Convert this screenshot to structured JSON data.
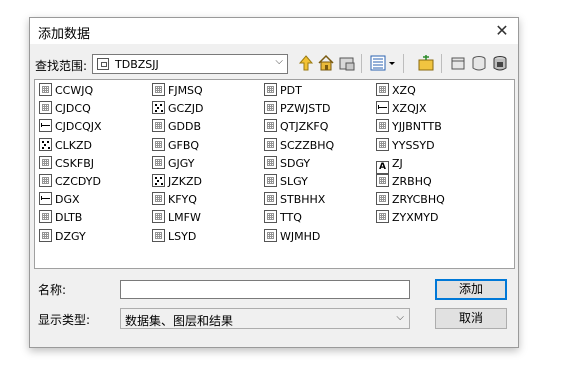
{
  "dialog": {
    "title": "添加数据"
  },
  "lookin": {
    "label": "查找范围:",
    "value": "TDBZSJJ"
  },
  "items": [
    {
      "label": "CCWJQ",
      "type": "raster"
    },
    {
      "label": "CJDCQ",
      "type": "raster"
    },
    {
      "label": "CJDCQJX",
      "type": "line"
    },
    {
      "label": "CLKZD",
      "type": "point"
    },
    {
      "label": "CSKFBJ",
      "type": "raster"
    },
    {
      "label": "CZCDYD",
      "type": "raster"
    },
    {
      "label": "DGX",
      "type": "line"
    },
    {
      "label": "DLTB",
      "type": "raster"
    },
    {
      "label": "DZGY",
      "type": "raster"
    },
    {
      "label": "FJMSQ",
      "type": "raster"
    },
    {
      "label": "GCZJD",
      "type": "point"
    },
    {
      "label": "GDDB",
      "type": "raster"
    },
    {
      "label": "GFBQ",
      "type": "raster"
    },
    {
      "label": "GJGY",
      "type": "raster"
    },
    {
      "label": "JZKZD",
      "type": "point"
    },
    {
      "label": "KFYQ",
      "type": "raster"
    },
    {
      "label": "LMFW",
      "type": "raster"
    },
    {
      "label": "LSYD",
      "type": "raster"
    },
    {
      "label": "PDT",
      "type": "raster"
    },
    {
      "label": "PZWJSTD",
      "type": "raster"
    },
    {
      "label": "QTJZKFQ",
      "type": "raster"
    },
    {
      "label": "SCZZBHQ",
      "type": "raster"
    },
    {
      "label": "SDGY",
      "type": "raster"
    },
    {
      "label": "SLGY",
      "type": "raster"
    },
    {
      "label": "STBHHX",
      "type": "raster"
    },
    {
      "label": "TTQ",
      "type": "raster"
    },
    {
      "label": "WJMHD",
      "type": "raster"
    },
    {
      "label": "XZQ",
      "type": "raster"
    },
    {
      "label": "XZQJX",
      "type": "line"
    },
    {
      "label": "YJJBNTTB",
      "type": "raster"
    },
    {
      "label": "YYSSYD",
      "type": "raster"
    },
    {
      "label": "ZJ",
      "type": "annotation",
      "glyph": "A"
    },
    {
      "label": "ZRBHQ",
      "type": "raster"
    },
    {
      "label": "ZRYCBHQ",
      "type": "raster"
    },
    {
      "label": "ZYXMYD",
      "type": "raster"
    }
  ],
  "name": {
    "label": "名称:",
    "value": ""
  },
  "filetype": {
    "label": "显示类型:",
    "value": "数据集、图层和结果"
  },
  "buttons": {
    "add": "添加",
    "cancel": "取消"
  },
  "icons": [
    "close-icon",
    "up-folder-icon",
    "home-icon",
    "folder-connect-icon",
    "list-view-icon",
    "view-dropdown-icon",
    "new-folder-icon",
    "catalog-icon",
    "database-icon",
    "geodatabase-icon"
  ]
}
